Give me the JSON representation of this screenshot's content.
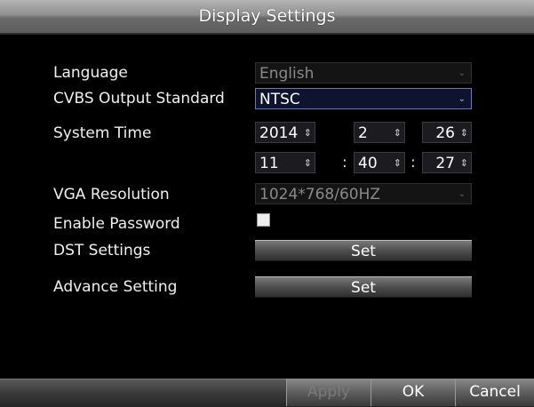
{
  "window": {
    "title": "Display Settings"
  },
  "labels": {
    "language": "Language",
    "cvbs": "CVBS Output Standard",
    "system_time": "System Time",
    "vga": "VGA Resolution",
    "enable_password": "Enable Password",
    "dst": "DST Settings",
    "advance": "Advance Setting"
  },
  "fields": {
    "language": {
      "value": "English",
      "enabled": false
    },
    "cvbs": {
      "value": "NTSC",
      "enabled": true
    },
    "vga": {
      "value": "1024*768/60HZ",
      "enabled": false
    },
    "year": "2014",
    "month": "2",
    "day": "26",
    "hour": "11",
    "minute": "40",
    "second": "27",
    "time_separator": ":",
    "enable_password_checked": false
  },
  "buttons": {
    "dst_set": "Set",
    "advance_set": "Set",
    "apply": "Apply",
    "ok": "OK",
    "cancel": "Cancel"
  },
  "icons": {
    "dropdown": "chevron-down-icon",
    "spinner": "up-down-spinner-icon"
  }
}
